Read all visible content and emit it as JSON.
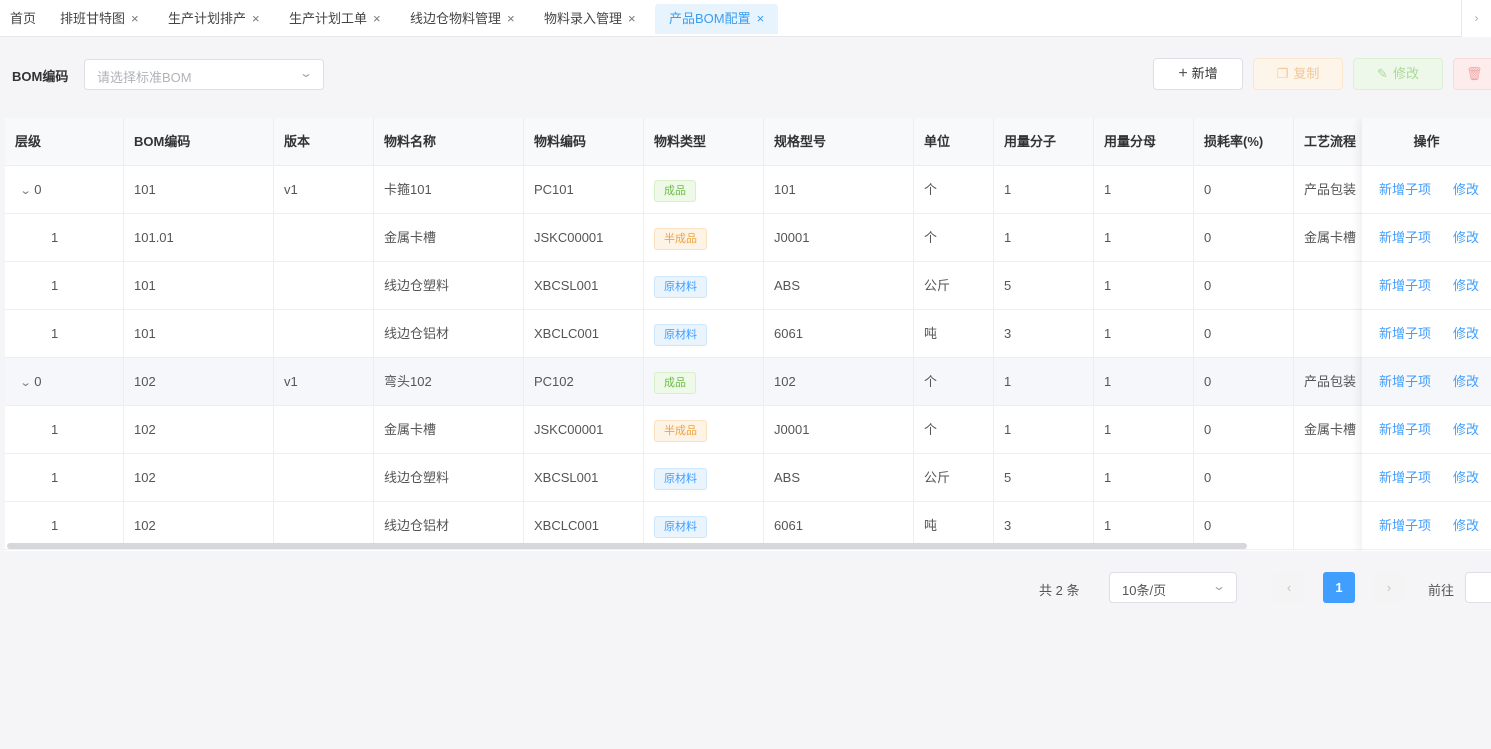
{
  "tabs": [
    {
      "label": "首页",
      "closable": false
    },
    {
      "label": "排班甘特图",
      "closable": true
    },
    {
      "label": "生产计划排产",
      "closable": true
    },
    {
      "label": "生产计划工单",
      "closable": true
    },
    {
      "label": "线边仓物料管理",
      "closable": true
    },
    {
      "label": "物料录入管理",
      "closable": true
    },
    {
      "label": "产品BOM配置",
      "closable": true,
      "active": true
    }
  ],
  "tab_close_glyph": "×",
  "tabs_scroll_glyph": "›",
  "filter": {
    "label": "BOM编码",
    "placeholder": "请选择标准BOM"
  },
  "toolbar": {
    "add_label": "新增",
    "copy_label": "复制",
    "edit_label": "修改",
    "delete_label": ""
  },
  "colors": {
    "accent": "#409eff",
    "tag_finished": "#6abf47",
    "tag_semi": "#f0a33e",
    "tag_raw": "#409eff"
  },
  "table": {
    "columns": [
      "层级",
      "BOM编码",
      "版本",
      "物料名称",
      "物料编码",
      "物料类型",
      "规格型号",
      "单位",
      "用量分子",
      "用量分母",
      "损耗率(%)",
      "工艺流程"
    ],
    "ops_header": "操作",
    "rows": [
      {
        "level": "0",
        "expandable": true,
        "bom": "101",
        "version": "v1",
        "name": "卡箍101",
        "code": "PC101",
        "type": "成品",
        "type_kind": "green",
        "spec": "101",
        "unit": "个",
        "num": "1",
        "den": "1",
        "loss": "0",
        "process": "产品包装",
        "highlight": false
      },
      {
        "level": "1",
        "expandable": false,
        "bom": "101.01",
        "version": "",
        "name": "金属卡槽",
        "code": "JSKC00001",
        "type": "半成品",
        "type_kind": "orange",
        "spec": "J0001",
        "unit": "个",
        "num": "1",
        "den": "1",
        "loss": "0",
        "process": "金属卡槽",
        "highlight": false
      },
      {
        "level": "1",
        "expandable": false,
        "bom": "101",
        "version": "",
        "name": "线边仓塑料",
        "code": "XBCSL001",
        "type": "原材料",
        "type_kind": "blue",
        "spec": "ABS",
        "unit": "公斤",
        "num": "5",
        "den": "1",
        "loss": "0",
        "process": "",
        "highlight": false
      },
      {
        "level": "1",
        "expandable": false,
        "bom": "101",
        "version": "",
        "name": "线边仓铝材",
        "code": "XBCLC001",
        "type": "原材料",
        "type_kind": "blue",
        "spec": "6061",
        "unit": "吨",
        "num": "3",
        "den": "1",
        "loss": "0",
        "process": "",
        "highlight": false
      },
      {
        "level": "0",
        "expandable": true,
        "bom": "102",
        "version": "v1",
        "name": "弯头102",
        "code": "PC102",
        "type": "成品",
        "type_kind": "green",
        "spec": "102",
        "unit": "个",
        "num": "1",
        "den": "1",
        "loss": "0",
        "process": "产品包装",
        "highlight": true
      },
      {
        "level": "1",
        "expandable": false,
        "bom": "102",
        "version": "",
        "name": "金属卡槽",
        "code": "JSKC00001",
        "type": "半成品",
        "type_kind": "orange",
        "spec": "J0001",
        "unit": "个",
        "num": "1",
        "den": "1",
        "loss": "0",
        "process": "金属卡槽",
        "highlight": false
      },
      {
        "level": "1",
        "expandable": false,
        "bom": "102",
        "version": "",
        "name": "线边仓塑料",
        "code": "XBCSL001",
        "type": "原材料",
        "type_kind": "blue",
        "spec": "ABS",
        "unit": "公斤",
        "num": "5",
        "den": "1",
        "loss": "0",
        "process": "",
        "highlight": false
      },
      {
        "level": "1",
        "expandable": false,
        "bom": "102",
        "version": "",
        "name": "线边仓铝材",
        "code": "XBCLC001",
        "type": "原材料",
        "type_kind": "blue",
        "spec": "6061",
        "unit": "吨",
        "num": "3",
        "den": "1",
        "loss": "0",
        "process": "",
        "highlight": false
      }
    ],
    "row_actions": {
      "add_child": "新增子项",
      "edit": "修改"
    }
  },
  "pagination": {
    "total_text": "共 2 条",
    "page_size": "10条/页",
    "current_page": "1",
    "prev_glyph": "‹",
    "next_glyph": "›",
    "goto_label": "前往"
  }
}
